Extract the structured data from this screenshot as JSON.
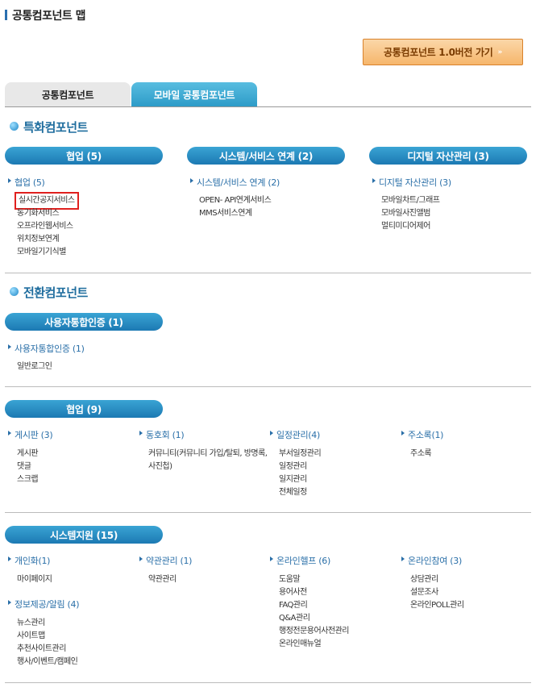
{
  "page": {
    "title": "공통컴포넌트 맵"
  },
  "go_button": {
    "label": "공통컴포넌트 1.0버전 가기",
    "arrows": "»"
  },
  "tabs": [
    {
      "label": "공통컴포넌트"
    },
    {
      "label": "모바일 공통컴포넌트"
    }
  ],
  "sections": [
    {
      "title": "특화컴포넌트"
    },
    {
      "title": "전환컴포넌트"
    }
  ],
  "special": {
    "pills": [
      "협업 (5)",
      "시스템/서비스 연계 (2)",
      "디지털 자산관리 (3)"
    ],
    "cats": [
      "협업 (5)",
      "시스템/서비스 연계 (2)",
      "디지털 자산관리 (3)"
    ],
    "col1": [
      "실시간공지서비스",
      "동기화서비스",
      "오프라인웹서비스",
      "위치정보연계",
      "모바일기기식별"
    ],
    "col2": [
      "OPEN- API연계서비스",
      "MMS서비스연계"
    ],
    "col3": [
      "모바일차트/그래프",
      "모바일사진앨범",
      "멀티미디어제어"
    ]
  },
  "auth": {
    "pill": "사용자통합인증 (1)",
    "cat": "사용자통합인증 (1)",
    "items": [
      "일반로그인"
    ]
  },
  "collab": {
    "pill": "협업 (9)",
    "cats": [
      "게시판 (3)",
      "동호회 (1)",
      "일정관리(4)",
      "주소록(1)"
    ],
    "col1": [
      "게시판",
      "댓글",
      "스크랩"
    ],
    "col2": [
      "커뮤니티(커뮤니티 가입/탈퇴, 방명록, 사진첩)"
    ],
    "col3": [
      "부서일정관리",
      "일정관리",
      "일지관리",
      "전체일정"
    ],
    "col4": [
      "주소록"
    ]
  },
  "system": {
    "pill": "시스템지원 (15)",
    "cats": [
      "개인화(1)",
      "약관관리 (1)",
      "온라인헬프 (6)",
      "온라인참여 (3)",
      "정보제공/알림 (4)"
    ],
    "col1": [
      "마이페이지"
    ],
    "col2": [
      "약관관리"
    ],
    "col3": [
      "도움말",
      "용어사전",
      "FAQ관리",
      "Q&A관리",
      "행정전문용어사전관리",
      "온라인매뉴얼"
    ],
    "col4": [
      "상담관리",
      "설문조사",
      "온라인POLL관리"
    ],
    "col5": [
      "뉴스관리",
      "사이트맵",
      "추천사이트관리",
      "행사/이벤트/캠페인"
    ]
  }
}
